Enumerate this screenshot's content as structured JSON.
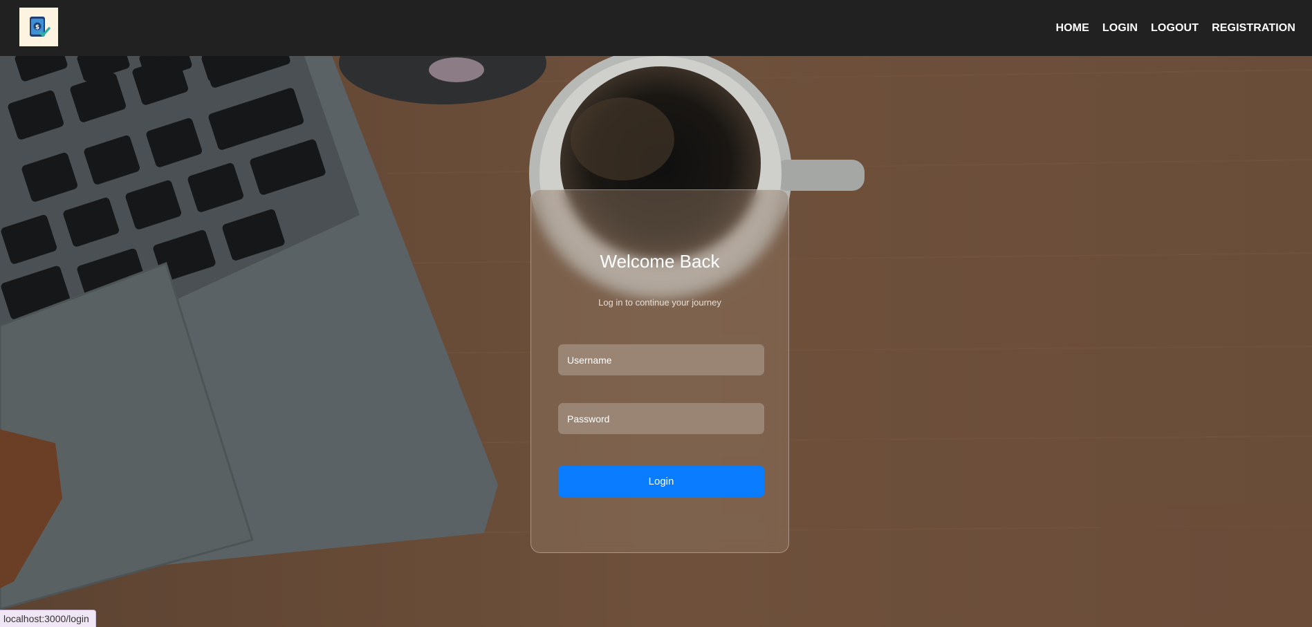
{
  "nav": {
    "logo_alt": "budget app logo",
    "links": [
      "HOME",
      "LOGIN",
      "LOGOUT",
      "REGISTRATION"
    ]
  },
  "login_card": {
    "title": "Welcome Back",
    "subtitle": "Log in to continue your journey",
    "username_placeholder": "Username",
    "password_placeholder": "Password",
    "submit_label": "Login"
  },
  "status_bar": {
    "url": "localhost:3000/login"
  },
  "colors": {
    "navbar_bg": "#212121",
    "button_accent": "#0a7cff",
    "card_bg": "rgba(145,120,100,0.45)"
  },
  "icons": {
    "logo": "wallet-dollar-check-icon"
  }
}
